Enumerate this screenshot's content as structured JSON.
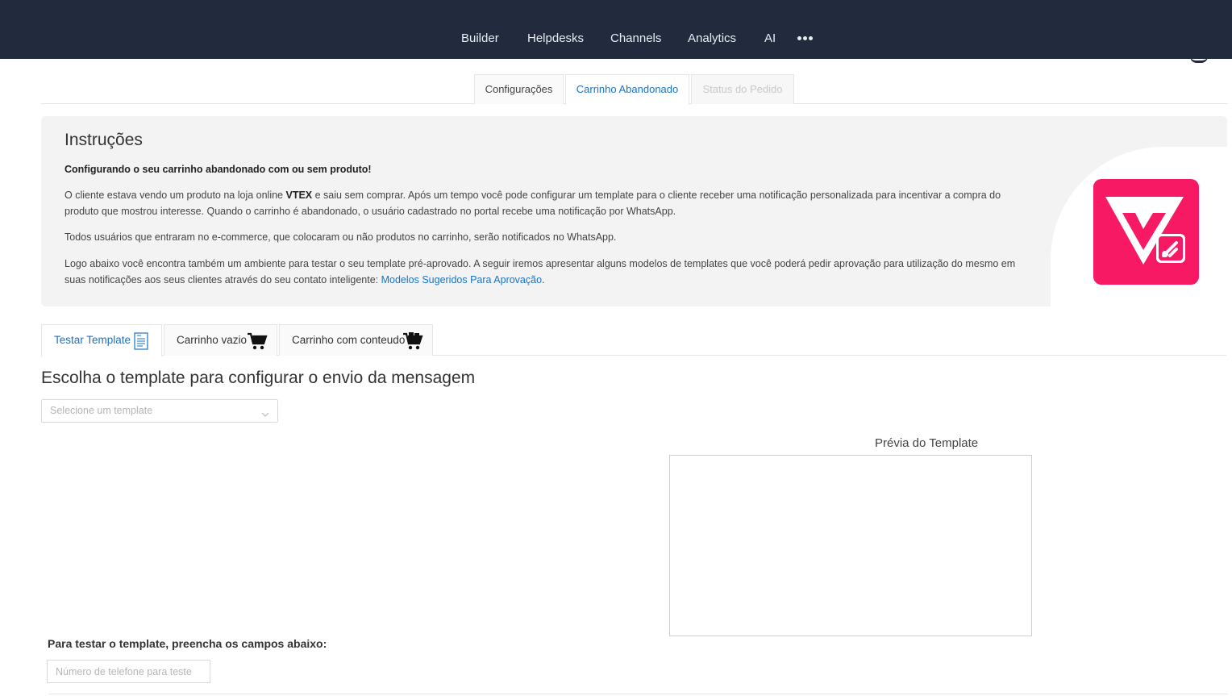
{
  "nav": {
    "items": [
      "Builder",
      "Helpdesks",
      "Channels",
      "Analytics",
      "AI"
    ],
    "more_icon": "more-horizontal-icon"
  },
  "top_tabs": {
    "configuracoes": "Configurações",
    "carrinho": "Carrinho Abandonado",
    "status": "Status do Pedido"
  },
  "instructions": {
    "title": "Instruções",
    "subtitle": "Configurando o seu carrinho abandonado com ou sem produto!",
    "p1_before": "O cliente estava vendo um produto na loja online ",
    "p1_brand": "VTEX",
    "p1_after": " e saiu sem comprar. Após um tempo você pode configurar um template para o cliente receber uma notificação personalizada para incentivar a compra do produto que mostrou interesse. Quando o carrinho é abandonado, o usuário cadastrado no portal recebe uma notificação por WhatsApp.",
    "p2": "Todos usuários que entraram no e-commerce, que colocaram ou não produtos no carrinho, serão notificados no WhatsApp.",
    "p3": "Logo abaixo você encontra também um ambiente para testar o seu template pré-aprovado. A seguir iremos apresentar alguns modelos de templates que você poderá pedir aprovação para utilização do mesmo em suas notificações aos seus clientes através do seu contato inteligente: ",
    "p3_link": "Modelos Sugeridos Para Aprovação",
    "p3_end": ".",
    "logo_icon": "vtex-logo-icon",
    "brand_color": "#f71963"
  },
  "sub_tabs": {
    "testar": "Testar Template",
    "vazio": "Carrinho vazio",
    "conteudo": "Carrinho com conteudo"
  },
  "main": {
    "section_title": "Escolha o template para configurar o envio da mensagem",
    "select_placeholder": "Selecione um template",
    "preview_title": "Prévia do Template",
    "test_label": "Para testar o template, preencha os campos abaixo:",
    "phone_placeholder": "Número de telefone para teste"
  },
  "colors": {
    "topbar": "#222b3e",
    "accent": "#1a73c8"
  }
}
